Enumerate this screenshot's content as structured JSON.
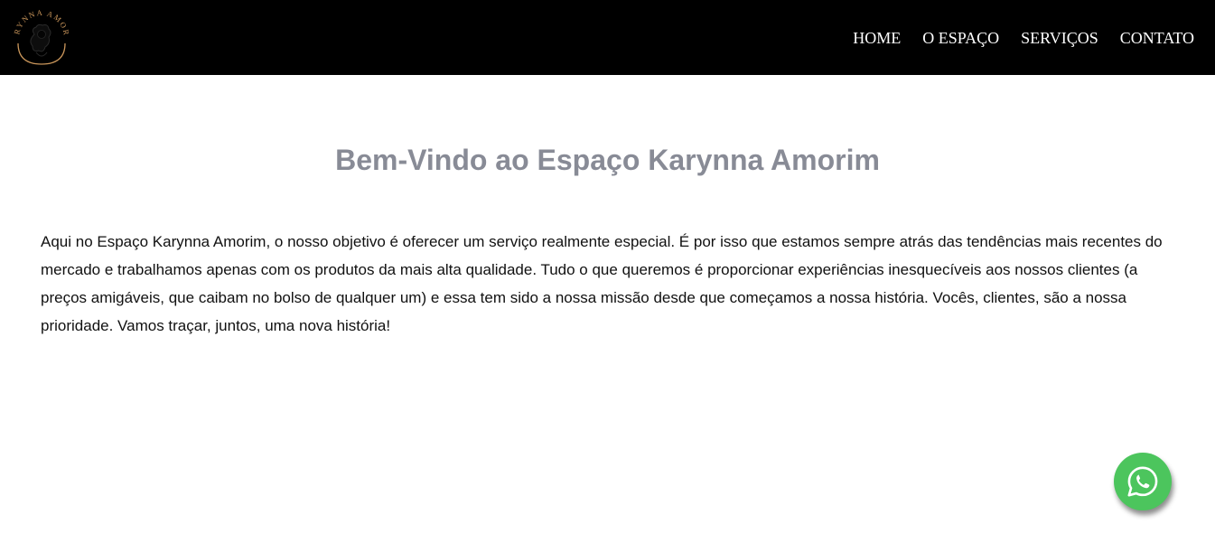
{
  "header": {
    "logo": {
      "text": "KARYNNA AMORIM",
      "icon": "logo-emblem-icon",
      "color": "#c9955a"
    },
    "nav": [
      {
        "label": "HOME"
      },
      {
        "label": "O ESPAÇO"
      },
      {
        "label": "SERVIÇOS"
      },
      {
        "label": "CONTATO"
      }
    ],
    "background": "#000000"
  },
  "main": {
    "title": "Bem-Vindo ao Espaço Karynna Amorim",
    "paragraph": "Aqui no Espaço Karynna Amorim, o nosso objetivo é oferecer um serviço realmente especial. É por isso que estamos sempre atrás das tendências mais recentes do mercado e trabalhamos apenas com os produtos da mais alta qualidade. Tudo o que queremos é proporcionar experiências inesquecíveis aos nossos clientes (a preços amigáveis, que caibam no bolso de qualquer um) e essa tem sido a nossa missão desde que começamos a nossa história. Vocês, clientes, são a nossa prioridade. Vamos traçar, juntos, uma nova história!",
    "title_color": "#888b96"
  },
  "floating": {
    "whatsapp": {
      "icon": "whatsapp-icon",
      "color": "#4cc55d"
    }
  }
}
